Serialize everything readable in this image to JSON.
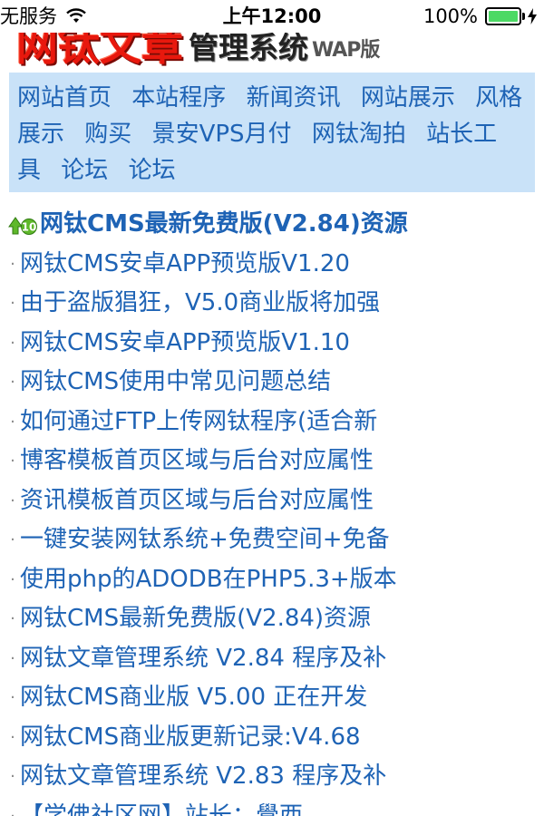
{
  "statusbar": {
    "carrier": "无服务",
    "time": "上午12:00",
    "battery_text": "100%",
    "battery_level": 1.0,
    "battery_color": "#4cd964"
  },
  "logo": {
    "main": "网钛文章",
    "sub": "管理系统",
    "wap": "WAP版"
  },
  "nav": {
    "items": [
      "网站首页",
      "本站程序",
      "新闻资讯",
      "网站展示",
      "风格展示",
      "购买",
      "景安VPS月付",
      "网钛淘拍",
      "站长工具",
      "论坛",
      "论坛"
    ]
  },
  "list": {
    "top": {
      "icon": "top10-icon",
      "text": "网钛CMS最新免费版(V2.84)资源"
    },
    "items": [
      "网钛CMS安卓APP预览版V1.20",
      "由于盗版猖狂，V5.0商业版将加强",
      "网钛CMS安卓APP预览版V1.10",
      "网钛CMS使用中常见问题总结",
      "如何通过FTP上传网钛程序(适合新",
      "博客模板首页区域与后台对应属性",
      "资讯模板首页区域与后台对应属性",
      "一键安装网钛系统+免费空间+免备",
      "使用php的ADODB在PHP5.3+版本",
      "网钛CMS最新免费版(V2.84)资源",
      "网钛文章管理系统 V2.84 程序及补",
      "网钛CMS商业版 V5.00 正在开发",
      "网钛CMS商业版更新记录:V4.68",
      "网钛文章管理系统 V2.83 程序及补",
      "【学佛社区网】站长：覺西"
    ]
  },
  "colors": {
    "link": "#1e63b5",
    "nav_bg": "#c9e2f8",
    "logo_red": "#e8180d"
  }
}
